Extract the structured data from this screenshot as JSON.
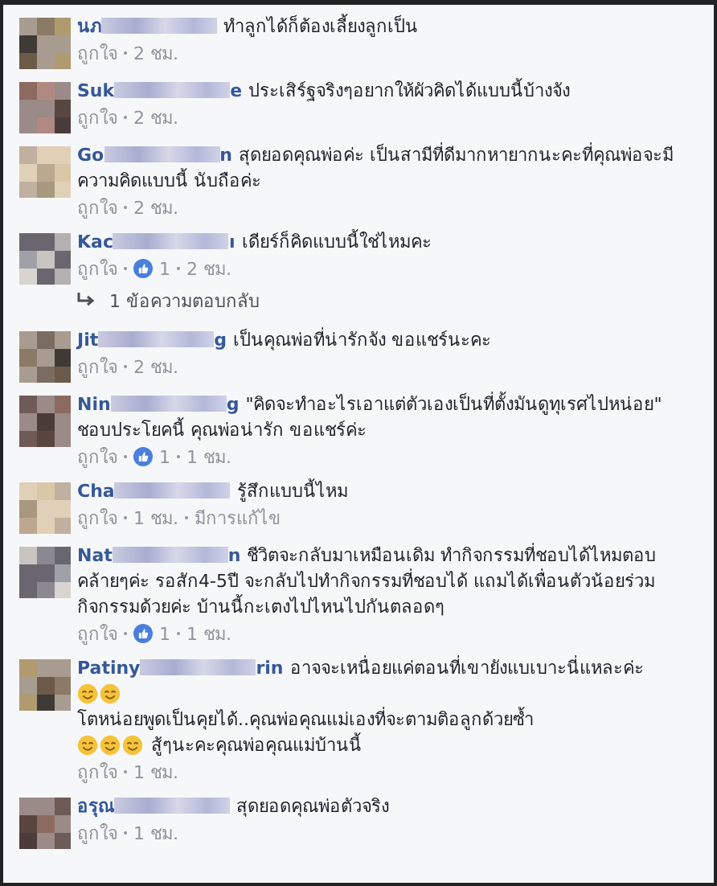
{
  "comments": [
    {
      "name": "นภ",
      "body": [
        {
          "kind": "text",
          "text": "ทำลูกได้ก็ต้องเลี้ยงลูกเป็น"
        }
      ],
      "like_label": "ถูกใจ",
      "time": "2 ชม."
    },
    {
      "name": "Suk",
      "name_tail": "e",
      "body": [
        {
          "kind": "text",
          "text": "ประเสิร์ฐจริงๆอยากให้ผัวคิดได้แบบนี้บ้างจัง"
        }
      ],
      "like_label": "ถูกใจ",
      "time": "2 ชม."
    },
    {
      "name": "Go",
      "name_tail": "n",
      "body": [
        {
          "kind": "text",
          "text": "สุดยอดคุณพ่อค่ะ เป็นสามีที่ดีมากหายากนะคะที่คุณพ่อจะมีความคิดแบบนี้ นับถือค่ะ"
        }
      ],
      "like_label": "ถูกใจ",
      "time": "2 ชม."
    },
    {
      "name": "Kac",
      "name_tail": "ı",
      "body": [
        {
          "kind": "text",
          "text": "เดียร์ก็คิดแบบนี้ใช่ไหมคะ"
        }
      ],
      "like_label": "ถูกใจ",
      "likes": "1",
      "time": "2 ชม.",
      "replies": "1 ข้อความตอบกลับ"
    },
    {
      "name": "Jit",
      "name_tail": "g",
      "body": [
        {
          "kind": "text",
          "text": "เป็นคุณพ่อที่น่ารักจัง ขอแชร์นะคะ"
        }
      ],
      "like_label": "ถูกใจ",
      "time": "2 ชม."
    },
    {
      "name": "Nin",
      "name_tail": "g",
      "body": [
        {
          "kind": "text",
          "text": "\"คิดจะทำอะไรเอาแต่ตัวเองเป็นที่ตั้งมันดูทุเรศไปหน่อย\" ชอบประโยคนี้ คุณพ่อน่ารัก ขอแชร์ค่ะ"
        }
      ],
      "like_label": "ถูกใจ",
      "likes": "1",
      "time": "1 ชม."
    },
    {
      "name": "Cha",
      "body": [
        {
          "kind": "text",
          "text": "รู้สึกแบบนี้ไหม"
        }
      ],
      "like_label": "ถูกใจ",
      "time": "1 ชม.",
      "edited": "มีการแก้ไข"
    },
    {
      "name": "Nat",
      "name_tail": "n",
      "body": [
        {
          "kind": "text",
          "text": "ชีวิตจะกลับมาเหมือนเดิม ทำกิจกรรมที่ชอบได้ไหมตอบ คล้ายๆค่ะ รอสัก4-5ปี จะกลับไปทำกิจกรรมที่ชอบได้ แถมได้เพื่อนตัวน้อยร่วมกิจกรรมด้วยค่ะ บ้านนี้กะเตงไปไหนไปกันตลอดๆ"
        }
      ],
      "like_label": "ถูกใจ",
      "likes": "1",
      "time": "1 ชม."
    },
    {
      "name": "Patiny",
      "name_tail": "rin",
      "body": [
        {
          "kind": "text",
          "text": "อาจจะเหนื่อยแค่ตอนที่เขายังแบเบาะนี่แหละค่ะ"
        },
        {
          "kind": "break"
        },
        {
          "kind": "smiley"
        },
        {
          "kind": "smiley"
        },
        {
          "kind": "break"
        },
        {
          "kind": "text",
          "text": "โตหน่อยพูดเป็นคุยได้..คุณพ่อคุณแม่เองที่จะตามติอลูกด้วยซ้ำ"
        },
        {
          "kind": "break"
        },
        {
          "kind": "smiley"
        },
        {
          "kind": "smiley"
        },
        {
          "kind": "smiley"
        },
        {
          "kind": "text",
          "text": "สู้ๆนะคะคุณพ่อคุณแม่บ้านนี้"
        }
      ],
      "like_label": "ถูกใจ",
      "time": "1 ชม."
    },
    {
      "name": "อรุณ",
      "body": [
        {
          "kind": "text",
          "text": "สุดยอดคุณพ่อตัวจริง"
        }
      ],
      "like_label": "ถูกใจ",
      "time": "1 ชม."
    }
  ]
}
